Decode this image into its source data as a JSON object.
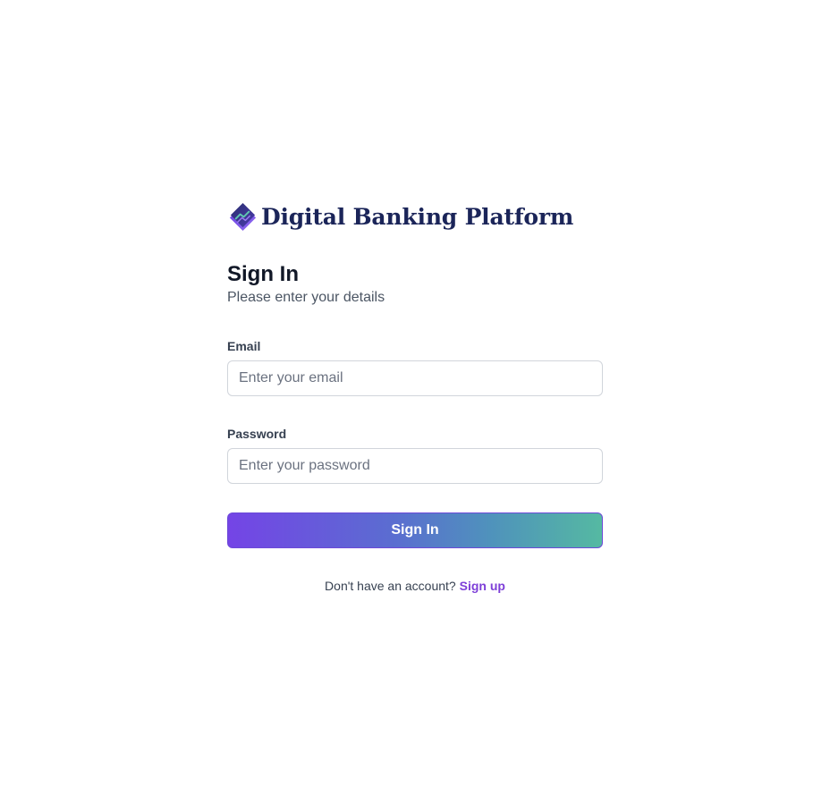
{
  "brand": {
    "name": "Digital Banking Platform",
    "logo_icon": "stacked-diamond-logo-icon",
    "colors": {
      "dark": "#1b2559",
      "purple": "#7444e6",
      "teal": "#55b9a2"
    }
  },
  "signin": {
    "title": "Sign In",
    "subtitle": "Please enter your details",
    "email": {
      "label": "Email",
      "placeholder": "Enter your email",
      "value": ""
    },
    "password": {
      "label": "Password",
      "placeholder": "Enter your password",
      "value": ""
    },
    "submit_label": "Sign In",
    "signup_prompt": "Don't have an account?",
    "signup_link": "Sign up"
  }
}
